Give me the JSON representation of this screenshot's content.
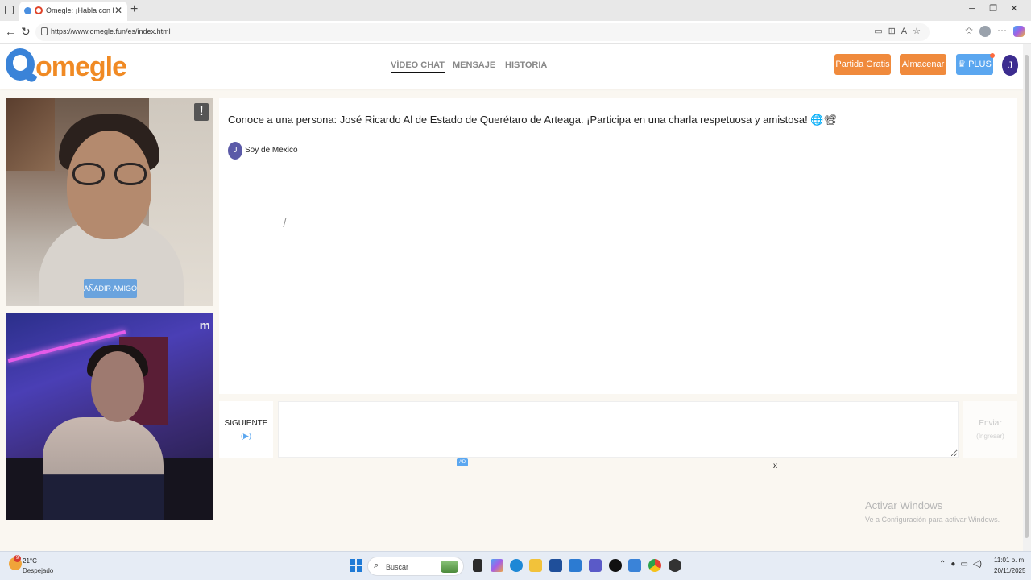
{
  "browser": {
    "tab_title": "Omegle: ¡Habla con Descon",
    "url": "https://www.omegle.fun/es/index.html"
  },
  "header": {
    "logo": "omegle",
    "nav": [
      "VÍDEO CHAT",
      "MENSAJE",
      "HISTORIA"
    ],
    "active_nav": "VÍDEO CHAT",
    "buttons": {
      "partida": "Partida Gratis",
      "almacenar": "Almacenar",
      "plus": "PLUS"
    },
    "avatar_letter": "J",
    "colors": {
      "brand_orange": "#f08a24",
      "brand_blue": "#3a83d8",
      "plus_blue": "#5ba7f0"
    }
  },
  "video": {
    "add_friend": "AÑADIR AMIGO",
    "report_icon": "!",
    "self_mark": "m"
  },
  "chat": {
    "intro": "Conoce a una persona: José Ricardo Al de Estado de Querétaro de Arteaga. ¡Participa en una charla respetuosa y amistosa! 🌐📽",
    "messages": [
      {
        "avatar": "J",
        "text": "Soy de Mexico"
      }
    ]
  },
  "controls": {
    "next_label": "SIGUIENTE",
    "next_hint": "(▶)",
    "send_label": "Enviar",
    "send_hint": "(Ingresar)",
    "ad_badge": "AD",
    "ad_close": "x"
  },
  "watermark": {
    "title": "Activar Windows",
    "subtitle": "Ve a Configuración para activar Windows."
  },
  "taskbar": {
    "weather_temp": "21°C",
    "weather_desc": "Despejado",
    "weather_badge": "9",
    "search_placeholder": "Buscar",
    "time": "11:01 p. m.",
    "date": "20/11/2025"
  }
}
